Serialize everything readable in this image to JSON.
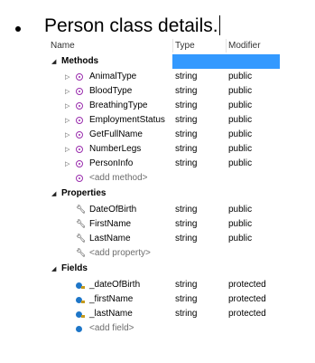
{
  "slide": {
    "text": "Person class details."
  },
  "columns": {
    "name": "Name",
    "type": "Type",
    "modifier": "Modifier"
  },
  "groups": {
    "methods": {
      "label": "Methods",
      "items": [
        {
          "name": "AnimalType",
          "type": "string",
          "modifier": "public"
        },
        {
          "name": "BloodType",
          "type": "string",
          "modifier": "public"
        },
        {
          "name": "BreathingType",
          "type": "string",
          "modifier": "public"
        },
        {
          "name": "EmploymentStatus",
          "type": "string",
          "modifier": "public"
        },
        {
          "name": "GetFullName",
          "type": "string",
          "modifier": "public"
        },
        {
          "name": "NumberLegs",
          "type": "string",
          "modifier": "public"
        },
        {
          "name": "PersonInfo",
          "type": "string",
          "modifier": "public"
        }
      ],
      "add": "<add method>"
    },
    "properties": {
      "label": "Properties",
      "items": [
        {
          "name": "DateOfBirth",
          "type": "string",
          "modifier": "public"
        },
        {
          "name": "FirstName",
          "type": "string",
          "modifier": "public"
        },
        {
          "name": "LastName",
          "type": "string",
          "modifier": "public"
        }
      ],
      "add": "<add property>"
    },
    "fields": {
      "label": "Fields",
      "items": [
        {
          "name": "_dateOfBirth",
          "type": "string",
          "modifier": "protected"
        },
        {
          "name": "_firstName",
          "type": "string",
          "modifier": "protected"
        },
        {
          "name": "_lastName",
          "type": "string",
          "modifier": "protected"
        }
      ],
      "add": "<add field>"
    }
  },
  "icons": {
    "expanded": "expanded-triangle-icon",
    "collapsed": "collapsed-triangle-icon",
    "method": "method-icon",
    "property": "property-wrench-icon",
    "field": "field-icon",
    "protected": "protected-lock-icon"
  },
  "colors": {
    "selection": "#3399ff",
    "method": "#9b2fae",
    "field": "#1e76c8"
  }
}
